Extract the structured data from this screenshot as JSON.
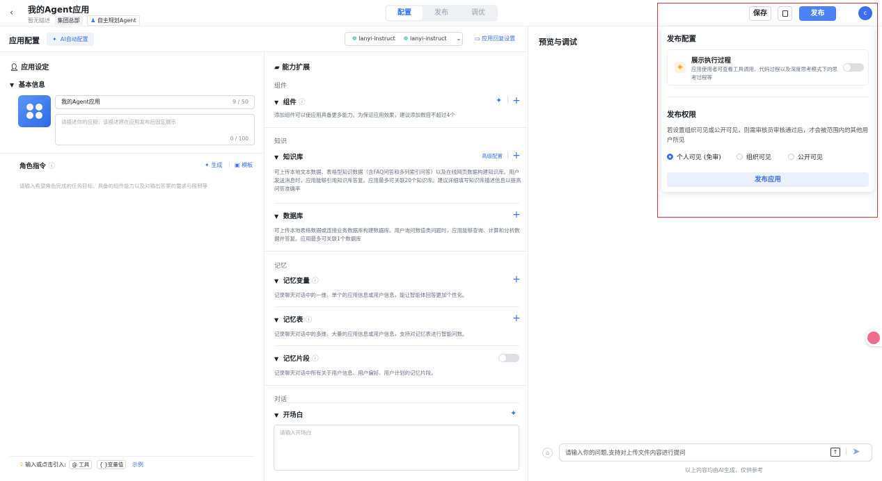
{
  "header": {
    "title": "我的Agent应用",
    "subtitle": "暂无描述",
    "tag_org": "集团总部",
    "tag_agent": "自主规划Agent",
    "tabs": [
      "配置",
      "发布",
      "调优"
    ],
    "save_label": "保存",
    "publish_label": "发布",
    "avatar_letter": "c"
  },
  "left": {
    "panel_title": "应用配置",
    "ai_config": "AI自动配置",
    "models": [
      "lanyi-instruct",
      "lanyi-instruct"
    ],
    "reply_setting": "应用回复设置",
    "app_settings": "应用设定",
    "basic_info": "基本信息",
    "name_value": "我的Agent应用",
    "name_count": "9 / 50",
    "desc_placeholder": "请描述你的应用，该描述将在应用发布后固定展示",
    "desc_count": "0 / 100",
    "role_title": "角色指令",
    "generate": "生成",
    "template": "模板",
    "role_placeholder": "请输入希望角色完成的任务目标、具备的组件能力以及对输出答案的要求与限制等",
    "bottom_hint": "输入或点击引入:",
    "chip_tool": "@ 工具",
    "chip_var": "{ }变量值",
    "example": "示例"
  },
  "ext": {
    "title": "能力扩展",
    "group_component": "组件",
    "component_label": "组件",
    "component_hint": "添加组件可以使应用具备更多能力。为保证应用效果，建议添加数目不超过4个",
    "group_knowledge": "知识",
    "kb_label": "知识库",
    "kb_advanced": "高级配置",
    "kb_hint": "可上传本地文本数据、表格型知识数据（含FAQ问答和多列索引问答）以及在线网页数据构建知识库。用户发送消息时，应用能够引用知识库答复。应用最多可关联20个知识库。建议详细填写知识库描述信息以提高问答准确率",
    "db_label": "数据库",
    "db_hint": "可上传本地表格数据或连接业务数据库构建数据库。用户询问数值类问题时，应用能够查询、计算和分析数据并答复。应用最多可关联1个数据库",
    "group_memory": "记忆",
    "mem_var_label": "记忆变量",
    "mem_var_hint": "记录聊天对话中的一维、单个的应用信息或用户信息，能让智能体回答更加个性化。",
    "mem_table_label": "记忆表",
    "mem_table_hint": "记录聊天对话中的多维、大量的应用信息或用户信息，支持对记忆表进行智能问数。",
    "mem_frag_label": "记忆片段",
    "mem_frag_hint": "记录聊天对话中所有关于用户信息、用户偏好、用户计划的记忆片段。",
    "group_dialog": "对话",
    "opening_label": "开场白",
    "opening_placeholder": "请输入开场白"
  },
  "preview": {
    "title": "预览与调试",
    "input_placeholder": "请输入你的问题,支持对上传文件内容进行提问",
    "footer": "以上内容均由AI生成，仅供参考"
  },
  "popup": {
    "config_title": "发布配置",
    "exec_title": "展示执行过程",
    "exec_desc": "应用使用者可查看工具调用、代码过程以及深度思考模式下的思考过程等",
    "perm_title": "发布权限",
    "perm_desc": "若设置组织可见或公开可见，则需审核员审核通过后，才会被范围内的其他用户所见",
    "options": [
      "个人可见 (免审)",
      "组织可见",
      "公开可见"
    ],
    "publish_app": "发布应用"
  },
  "colors": {
    "accent": "#3b72f2",
    "highlight": "#e0313b"
  }
}
